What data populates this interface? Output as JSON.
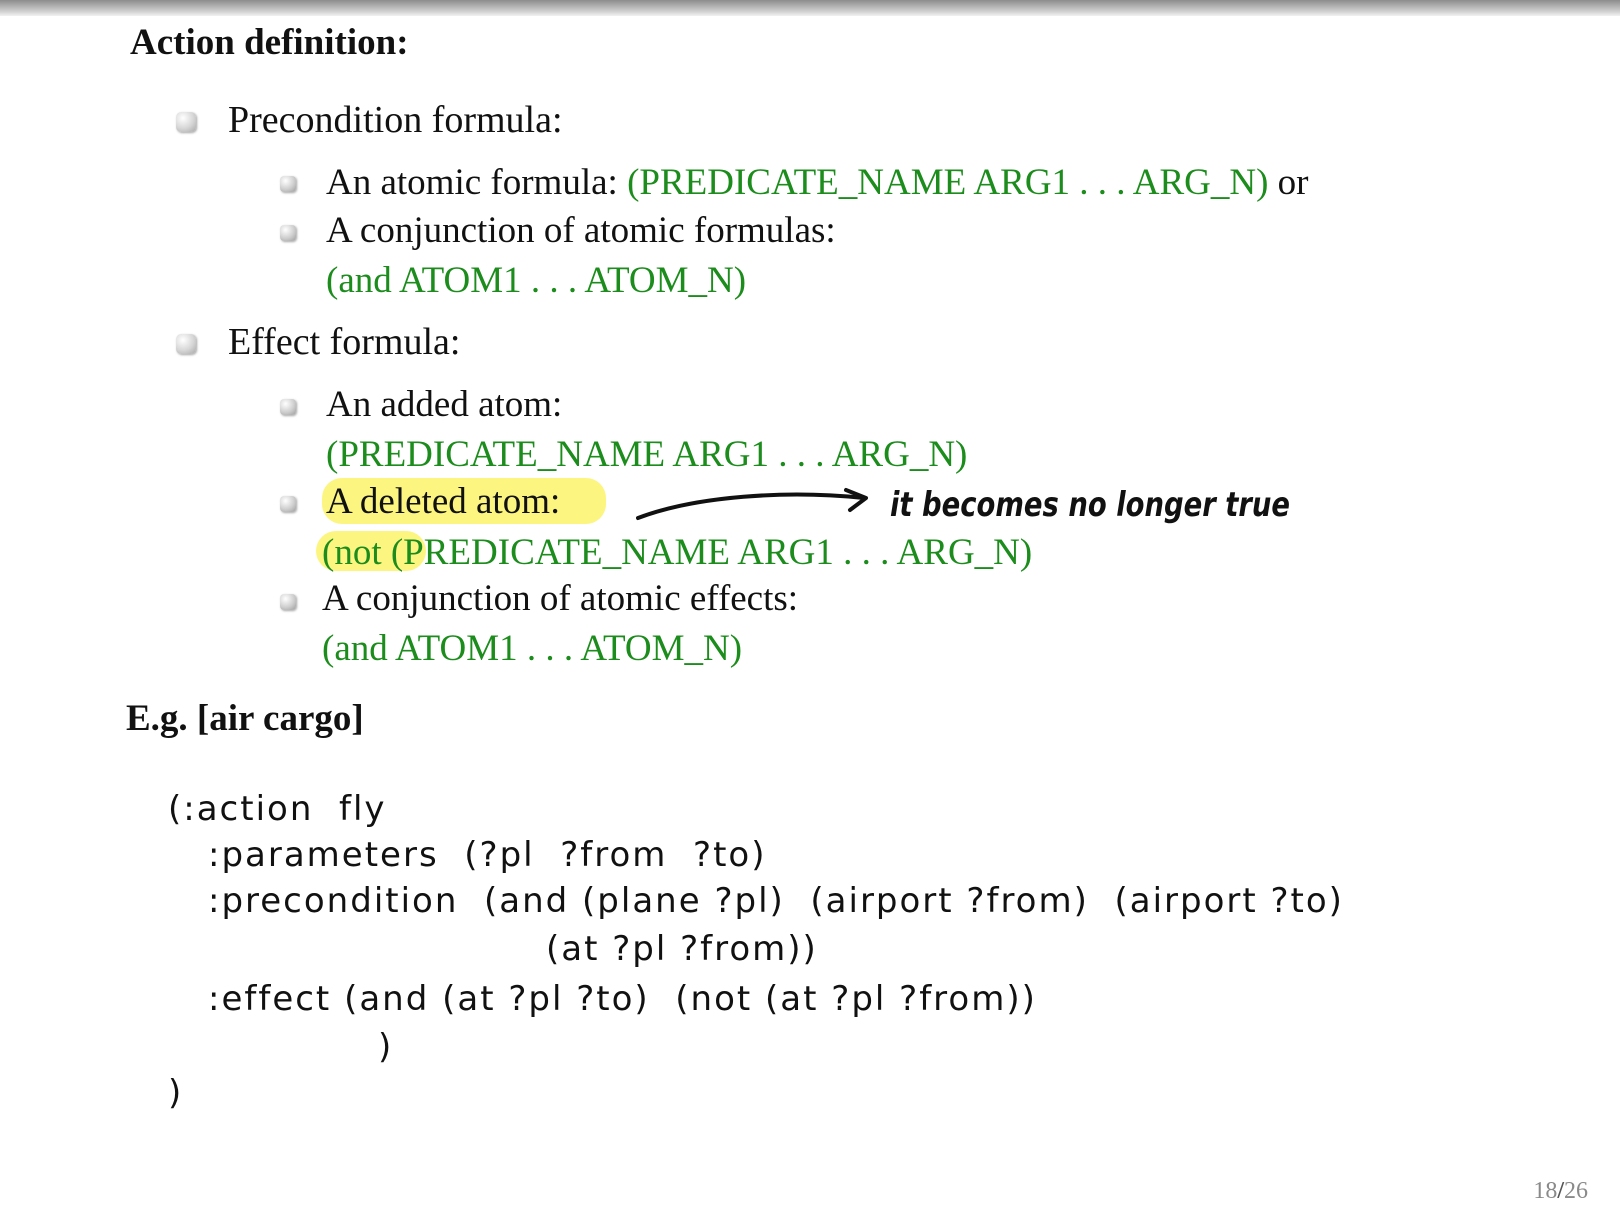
{
  "slide": {
    "section_title": "Action definition:",
    "precondition": {
      "label": "Precondition formula:",
      "atomic_text": "An atomic formula: ",
      "atomic_code": "(PREDICATE_NAME  ARG1 . . .  ARG_N)",
      "atomic_suffix": " or",
      "conjunction_text": "A conjunction of atomic formulas:",
      "conjunction_code": "(and  ATOM1 . . .     ATOM_N)"
    },
    "effect": {
      "label": "Effect formula:",
      "added_text": "An added atom:",
      "added_code": "(PREDICATE_NAME  ARG1 . . .     ARG_N)",
      "deleted_text": "A deleted atom:",
      "deleted_code_prefix": "(not ",
      "deleted_code_rest": "(PREDICATE_NAME  ARG1 . . .     ARG_N)",
      "conjunction_text": "A conjunction of atomic effects:",
      "conjunction_code": "(and  ATOM1 . . .     ATOM_N)"
    },
    "handwritten_note": "it becomes no longer true",
    "example_title": "E.g. [air cargo]",
    "code_lines": [
      "(:action  fly",
      ":parameters  (?pl  ?from  ?to)",
      ":precondition  (and (plane ?pl)  (airport ?from)  (airport ?to)",
      "(at ?pl ?from))",
      ":effect (and (at ?pl ?to)  (not (at ?pl ?from))",
      ")",
      ")"
    ],
    "page_current": "18",
    "page_total": "26"
  },
  "colors": {
    "code_green": "#1c8c1c",
    "highlight_yellow": "#fbf36a"
  }
}
